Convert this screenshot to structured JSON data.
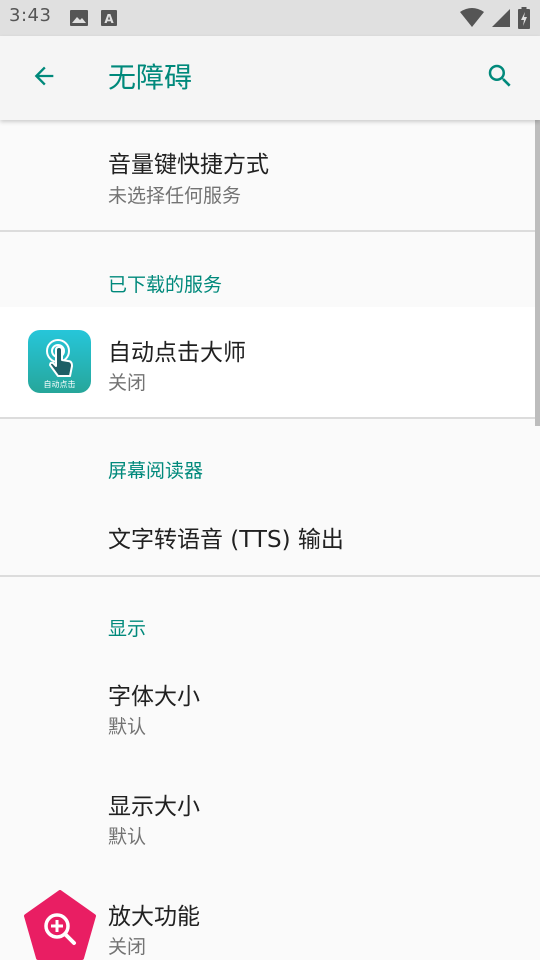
{
  "status_bar": {
    "time": "3:43"
  },
  "app_bar": {
    "title": "无障碍"
  },
  "items": {
    "volume_shortcut": {
      "title": "音量键快捷方式",
      "summary": "未选择任何服务"
    },
    "autoclick": {
      "title": "自动点击大师",
      "summary": "关闭",
      "icon_caption": "自动点击"
    },
    "tts": {
      "title": "文字转语音 (TTS) 输出"
    },
    "font_size": {
      "title": "字体大小",
      "summary": "默认"
    },
    "display_size": {
      "title": "显示大小",
      "summary": "默认"
    },
    "magnification": {
      "title": "放大功能",
      "summary": "关闭"
    }
  },
  "categories": {
    "downloaded": "已下载的服务",
    "screen_reader": "屏幕阅读器",
    "display": "显示"
  },
  "colors": {
    "accent": "#00897b",
    "status_bar": "#e0e0e0",
    "app_bar": "#f5f5f5",
    "background": "#fafafa",
    "magnify_icon": "#e91e63"
  }
}
